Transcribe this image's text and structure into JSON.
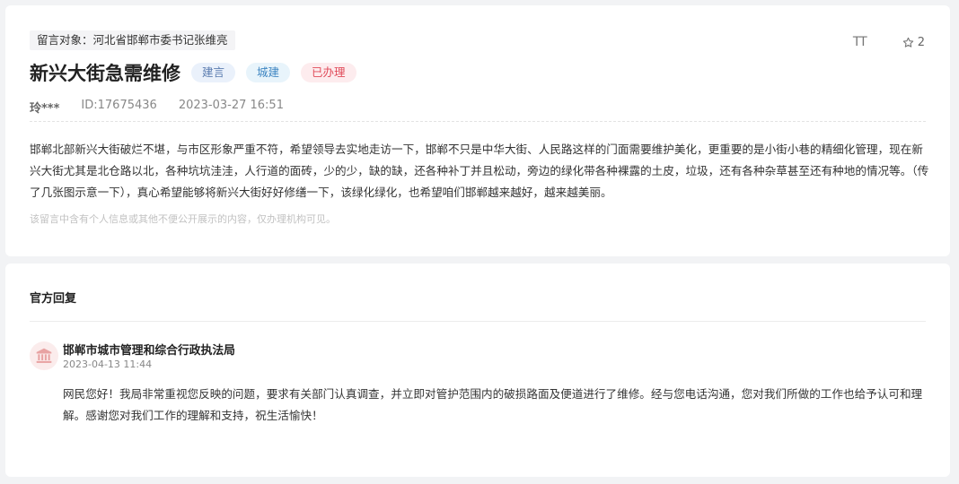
{
  "message": {
    "target_label": "留言对象：河北省邯郸市委书记张维亮",
    "font_tool_label": "TT",
    "star_count": "2",
    "title": "新兴大街急需维修",
    "tags": [
      "建言",
      "城建",
      "已办理"
    ],
    "author": "玲***",
    "id_text": "ID:17675436",
    "datetime": "2023-03-27 16:51",
    "content": "邯郸北部新兴大街破烂不堪，与市区形象严重不符，希望领导去实地走访一下，邯郸不只是中华大街、人民路这样的门面需要维护美化，更重要的是小街小巷的精细化管理，现在新兴大街尤其是北仓路以北，各种坑坑洼洼，人行道的面砖，少的少，缺的缺，还各种补丁并且松动，旁边的绿化带各种裸露的土皮，垃圾，还有各种杂草甚至还有种地的情况等。（传了几张图示意一下），真心希望能够将新兴大街好好修缮一下，该绿化绿化，也希望咱们邯郸越来越好，越来越美丽。",
    "privacy_note": "该留言中含有个人信息或其他不便公开展示的内容，仅办理机构可见。"
  },
  "reply": {
    "heading": "官方回复",
    "agency": "邯郸市城市管理和综合行政执法局",
    "datetime": "2023-04-13 11:44",
    "content": "网民您好！我局非常重视您反映的问题，要求有关部门认真调查，并立即对管护范围内的破损路面及便道进行了维修。经与您电话沟通，您对我们所做的工作也给予认可和理解。感谢您对我们工作的理解和支持，祝生活愉快！"
  },
  "colors": {
    "tag_red": "#e04b5a",
    "tag_blue": "#3f86c2",
    "avatar_icon": "#e8a3a3"
  },
  "icons": {
    "font_size": "font-size-icon",
    "star": "star-icon",
    "agency": "government-building-icon"
  }
}
